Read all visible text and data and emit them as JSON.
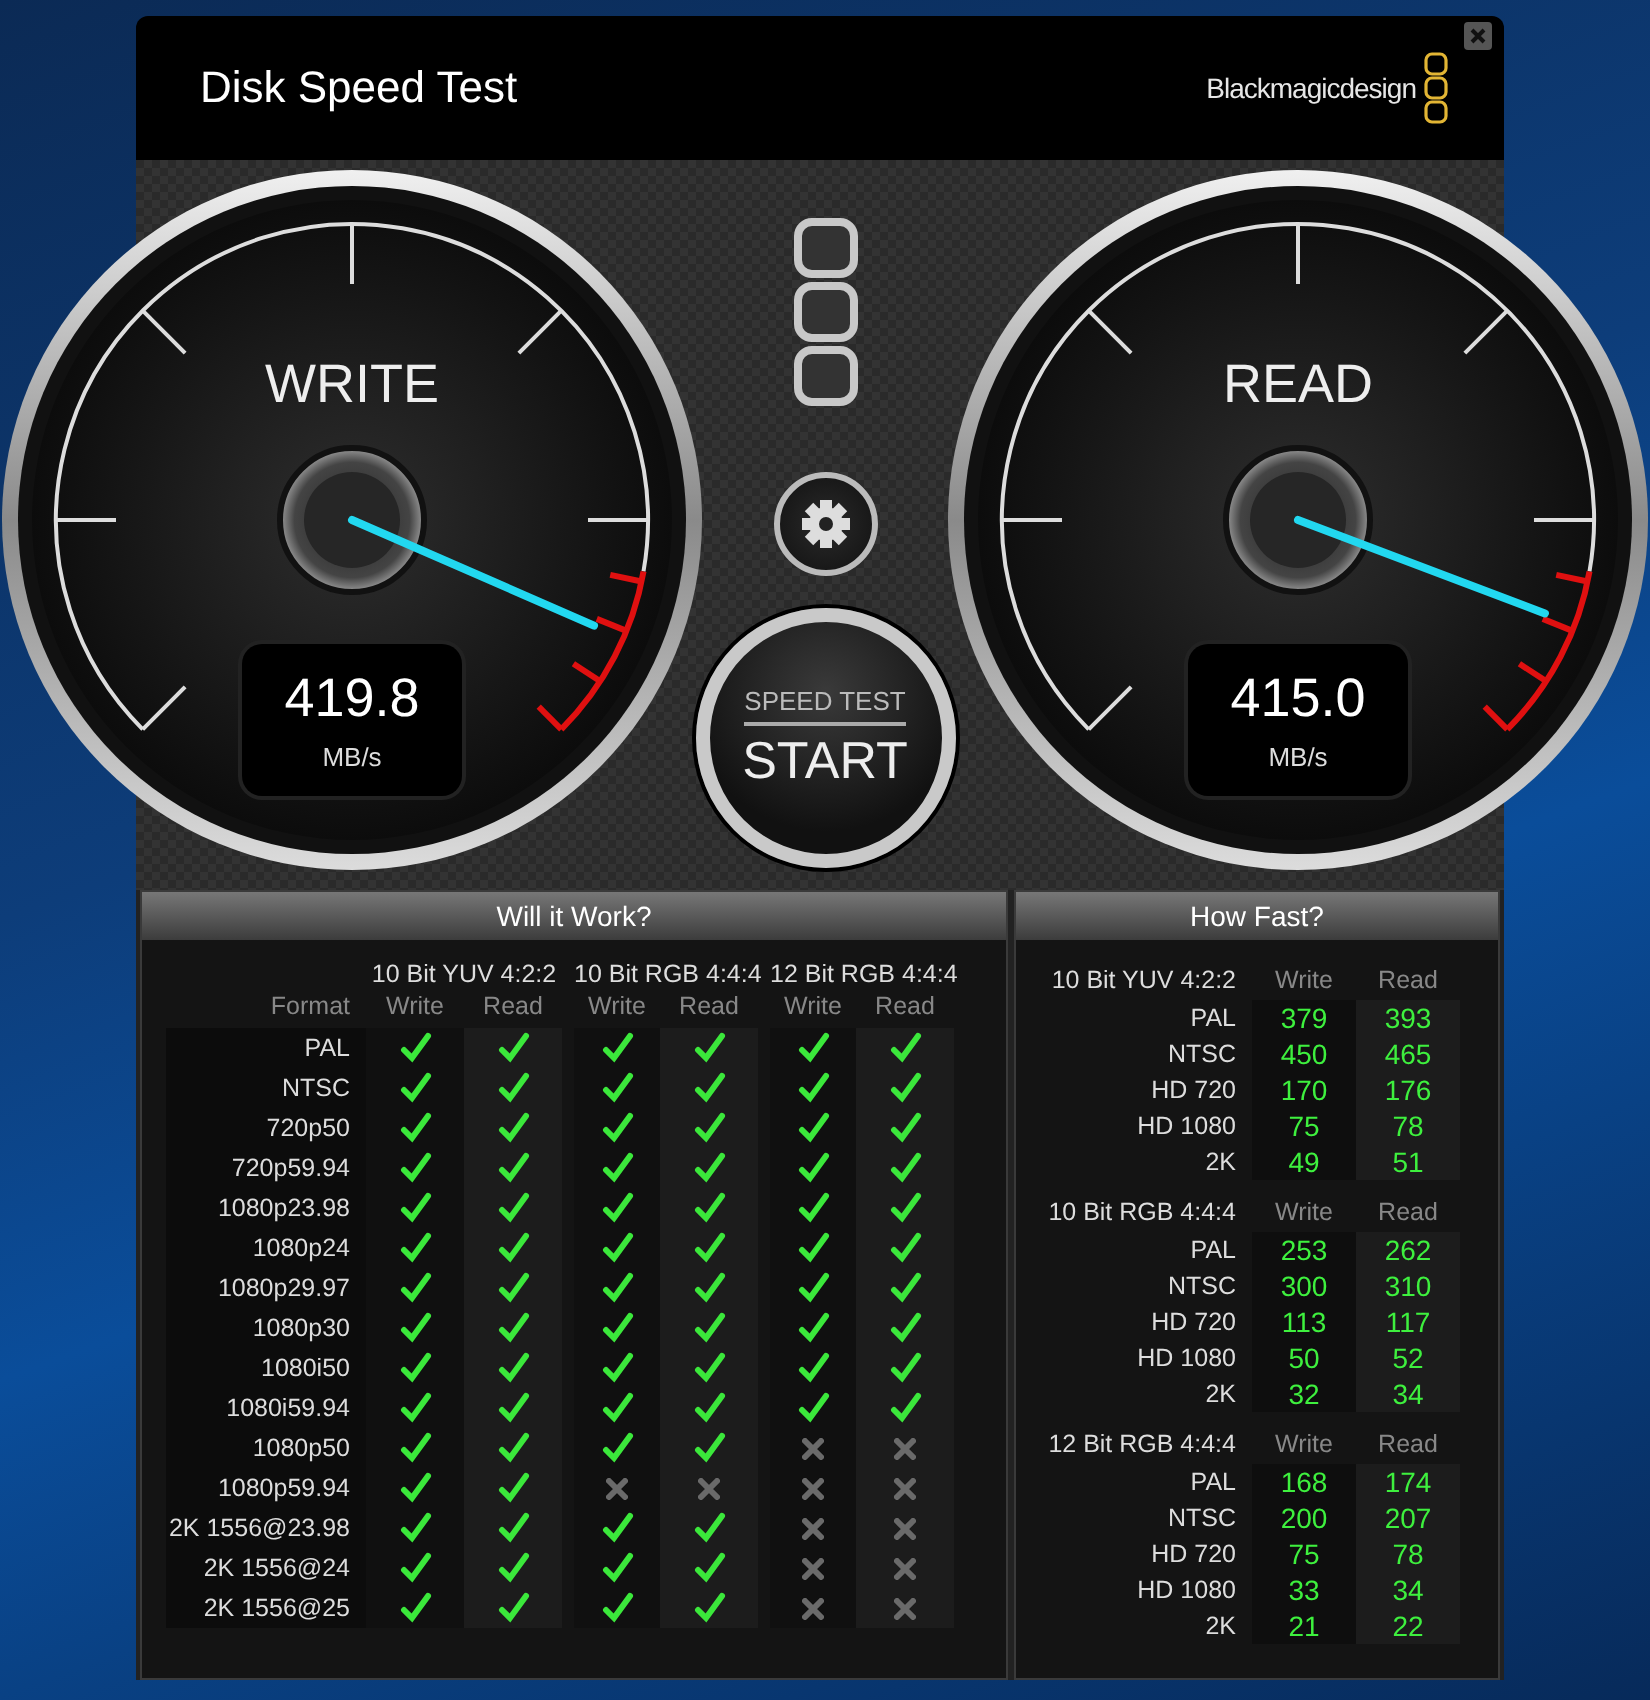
{
  "window": {
    "title": "Disk Speed Test",
    "brand": "Blackmagicdesign"
  },
  "gauges": [
    {
      "label": "WRITE",
      "value": "419.8",
      "unit": "MB/s"
    },
    {
      "label": "READ",
      "value": "415.0",
      "unit": "MB/s"
    }
  ],
  "start_button": {
    "top": "SPEED TEST",
    "bottom": "START"
  },
  "will_it_work": {
    "title": "Will it Work?",
    "format_header": "Format",
    "groups": [
      {
        "name": "10 Bit YUV 4:2:2",
        "columns": [
          "Write",
          "Read"
        ]
      },
      {
        "name": "10 Bit RGB 4:4:4",
        "columns": [
          "Write",
          "Read"
        ]
      },
      {
        "name": "12 Bit RGB 4:4:4",
        "columns": [
          "Write",
          "Read"
        ]
      }
    ],
    "rows": [
      {
        "format": "PAL",
        "results": [
          true,
          true,
          true,
          true,
          true,
          true
        ]
      },
      {
        "format": "NTSC",
        "results": [
          true,
          true,
          true,
          true,
          true,
          true
        ]
      },
      {
        "format": "720p50",
        "results": [
          true,
          true,
          true,
          true,
          true,
          true
        ]
      },
      {
        "format": "720p59.94",
        "results": [
          true,
          true,
          true,
          true,
          true,
          true
        ]
      },
      {
        "format": "1080p23.98",
        "results": [
          true,
          true,
          true,
          true,
          true,
          true
        ]
      },
      {
        "format": "1080p24",
        "results": [
          true,
          true,
          true,
          true,
          true,
          true
        ]
      },
      {
        "format": "1080p29.97",
        "results": [
          true,
          true,
          true,
          true,
          true,
          true
        ]
      },
      {
        "format": "1080p30",
        "results": [
          true,
          true,
          true,
          true,
          true,
          true
        ]
      },
      {
        "format": "1080i50",
        "results": [
          true,
          true,
          true,
          true,
          true,
          true
        ]
      },
      {
        "format": "1080i59.94",
        "results": [
          true,
          true,
          true,
          true,
          true,
          true
        ]
      },
      {
        "format": "1080p50",
        "results": [
          true,
          true,
          true,
          true,
          false,
          false
        ]
      },
      {
        "format": "1080p59.94",
        "results": [
          true,
          true,
          false,
          false,
          false,
          false
        ]
      },
      {
        "format": "2K 1556@23.98",
        "results": [
          true,
          true,
          true,
          true,
          false,
          false
        ]
      },
      {
        "format": "2K 1556@24",
        "results": [
          true,
          true,
          true,
          true,
          false,
          false
        ]
      },
      {
        "format": "2K 1556@25",
        "results": [
          true,
          true,
          true,
          true,
          false,
          false
        ]
      }
    ]
  },
  "how_fast": {
    "title": "How Fast?",
    "groups": [
      {
        "name": "10 Bit YUV 4:2:2",
        "columns": [
          "Write",
          "Read"
        ],
        "rows": [
          {
            "format": "PAL",
            "write": "379",
            "read": "393"
          },
          {
            "format": "NTSC",
            "write": "450",
            "read": "465"
          },
          {
            "format": "HD 720",
            "write": "170",
            "read": "176"
          },
          {
            "format": "HD 1080",
            "write": "75",
            "read": "78"
          },
          {
            "format": "2K",
            "write": "49",
            "read": "51"
          }
        ]
      },
      {
        "name": "10 Bit RGB 4:4:4",
        "columns": [
          "Write",
          "Read"
        ],
        "rows": [
          {
            "format": "PAL",
            "write": "253",
            "read": "262"
          },
          {
            "format": "NTSC",
            "write": "300",
            "read": "310"
          },
          {
            "format": "HD 720",
            "write": "113",
            "read": "117"
          },
          {
            "format": "HD 1080",
            "write": "50",
            "read": "52"
          },
          {
            "format": "2K",
            "write": "32",
            "read": "34"
          }
        ]
      },
      {
        "name": "12 Bit RGB 4:4:4",
        "columns": [
          "Write",
          "Read"
        ],
        "rows": [
          {
            "format": "PAL",
            "write": "168",
            "read": "174"
          },
          {
            "format": "NTSC",
            "write": "200",
            "read": "207"
          },
          {
            "format": "HD 720",
            "write": "75",
            "read": "78"
          },
          {
            "format": "HD 1080",
            "write": "33",
            "read": "34"
          },
          {
            "format": "2K",
            "write": "21",
            "read": "22"
          }
        ]
      }
    ]
  }
}
